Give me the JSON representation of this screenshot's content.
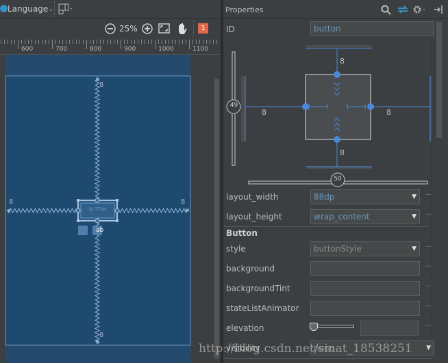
{
  "toolbar": {
    "language_label": "Language",
    "zoom_level": "25%",
    "warning_count": "1",
    "icons": [
      "globe-icon",
      "layout-variant-icon",
      "zoom-out-icon",
      "zoom-in-icon",
      "zoom-fit-icon",
      "pan-hand-icon"
    ]
  },
  "ruler": {
    "ticks": [
      "600",
      "700",
      "800",
      "900",
      "1000",
      "1100"
    ]
  },
  "canvas": {
    "button_text": "BUTTON",
    "margins": {
      "top": "8",
      "bottom": "8",
      "left": "8",
      "right": "8"
    },
    "colors": {
      "blueprint": "#1e4a70",
      "lines": "#7fa6cc"
    }
  },
  "properties": {
    "title": "Properties",
    "id_label": "ID",
    "id_value": "button",
    "inspector": {
      "margin_top": "8",
      "margin_bottom": "8",
      "margin_left": "8",
      "margin_right": "8",
      "vertical_bias": "49",
      "horizontal_bias": "50"
    },
    "rows": [
      {
        "label": "layout_width",
        "value": "88dp",
        "type": "dropdown"
      },
      {
        "label": "layout_height",
        "value": "wrap_content",
        "type": "dropdown"
      }
    ],
    "section": "Button",
    "button_rows": [
      {
        "label": "style",
        "value": "buttonStyle",
        "type": "dropdown"
      },
      {
        "label": "background",
        "value": "",
        "type": "text"
      },
      {
        "label": "backgroundTint",
        "value": "",
        "type": "text"
      },
      {
        "label": "stateListAnimator",
        "value": "",
        "type": "text"
      },
      {
        "label": "elevation",
        "value": "",
        "type": "slider"
      },
      {
        "label": "visibility",
        "value": "none",
        "type": "dropdown"
      }
    ],
    "ellipsis": "···"
  },
  "watermark": "http://blog.csdn.net/sinat_18538251"
}
